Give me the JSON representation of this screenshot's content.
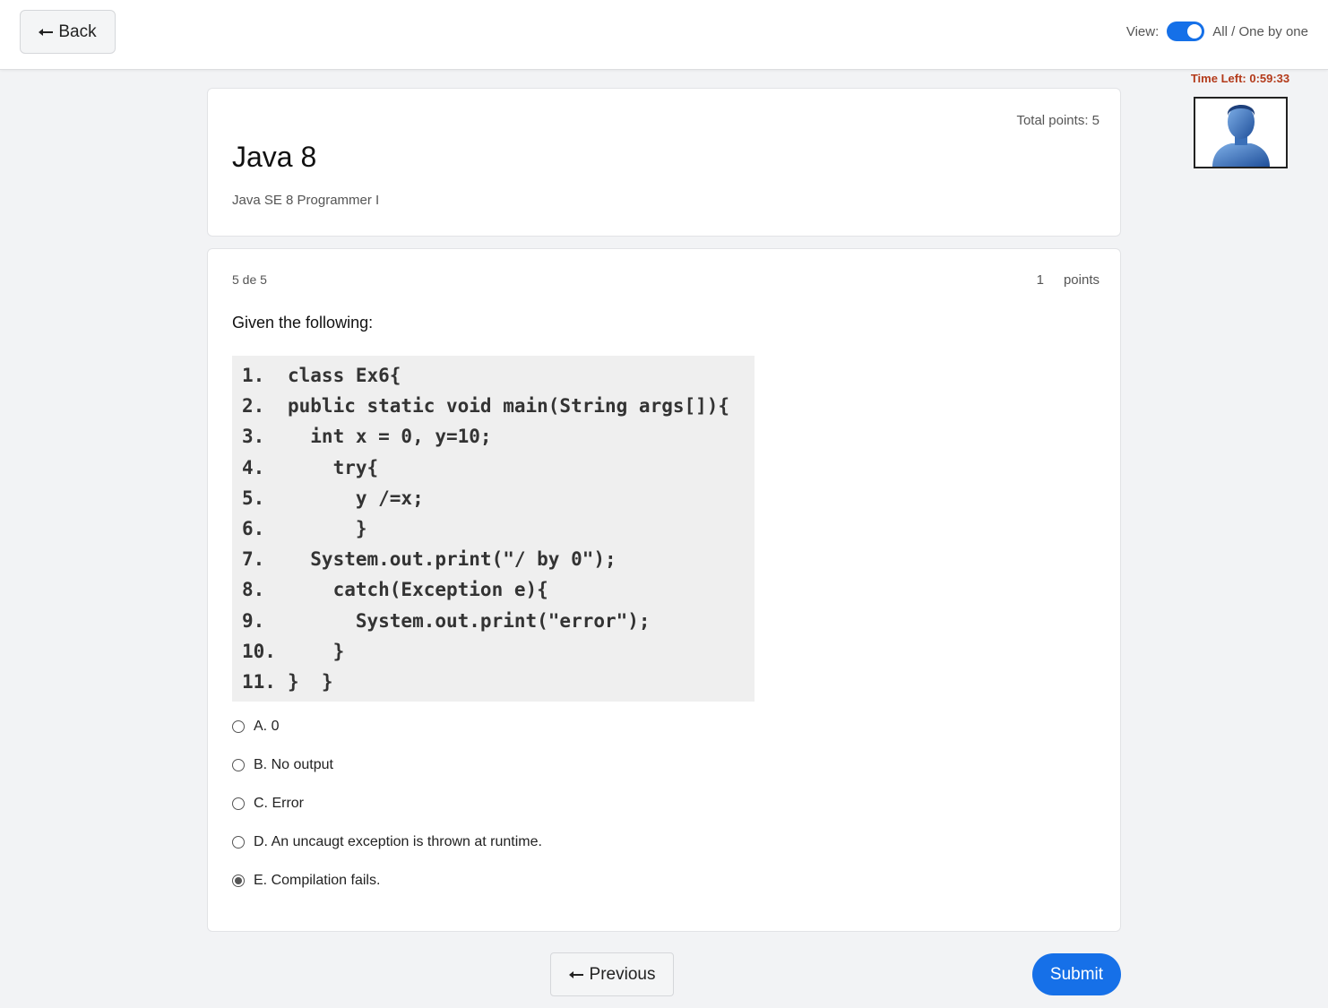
{
  "topbar": {
    "back_label": "Back",
    "view_label": "View:",
    "view_toggle_on": true,
    "view_mode_label": "All / One by one"
  },
  "timer": {
    "text": "Time Left: 0:59:33"
  },
  "quiz": {
    "total_points_label": "Total points:",
    "total_points_value": "5",
    "title": "Java 8",
    "subtitle": "Java SE 8 Programmer I"
  },
  "question": {
    "counter": "5 de 5",
    "points_value": "1",
    "points_label": "points",
    "prompt": "Given the following:",
    "code_lines": [
      {
        "num": "1.",
        "text": "class Ex6{"
      },
      {
        "num": "2.",
        "text": "public static void main(String args[]){"
      },
      {
        "num": "3.",
        "text": "  int x = 0, y=10;"
      },
      {
        "num": "4.",
        "text": "    try{"
      },
      {
        "num": "5.",
        "text": "      y /=x;"
      },
      {
        "num": "6.",
        "text": "      }"
      },
      {
        "num": "7.",
        "text": "  System.out.print(\"/ by 0\");"
      },
      {
        "num": "8.",
        "text": "    catch(Exception e){"
      },
      {
        "num": "9.",
        "text": "      System.out.print(\"error\");"
      },
      {
        "num": "10.",
        "text": "    }"
      },
      {
        "num": "11.",
        "text": "}  }"
      }
    ],
    "options": [
      {
        "label": "A. 0",
        "selected": false
      },
      {
        "label": "B. No output",
        "selected": false
      },
      {
        "label": "C. Error",
        "selected": false
      },
      {
        "label": "D. An uncaugt exception is thrown at runtime.",
        "selected": false
      },
      {
        "label": "E. Compilation fails.",
        "selected": true
      }
    ]
  },
  "footer": {
    "previous_label": "Previous",
    "submit_label": "Submit"
  },
  "colors": {
    "accent": "#1670e8",
    "timer": "#b33a1a",
    "background": "#f2f3f5"
  }
}
